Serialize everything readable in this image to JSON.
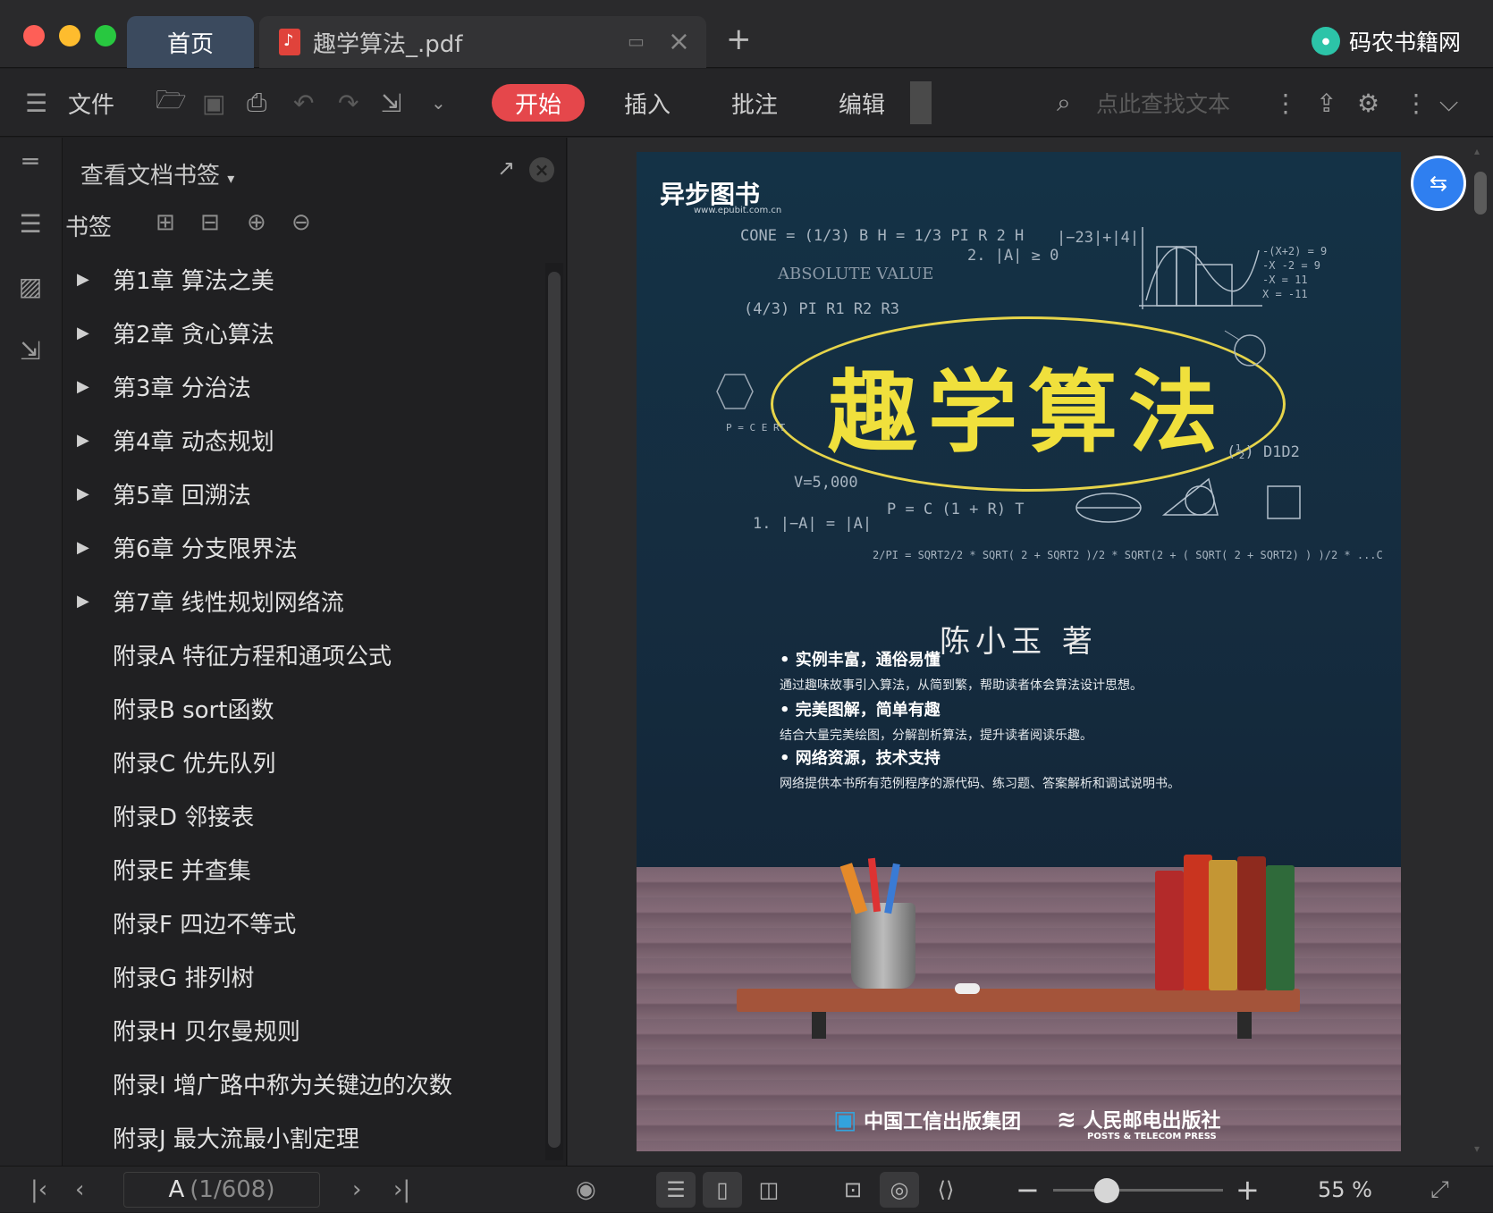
{
  "titlebar": {
    "home_tab": "首页",
    "doc_tab": "趣学算法_.pdf",
    "new_tab_symbol": "+",
    "brand": "码农书籍网"
  },
  "toolbar": {
    "menu_file": "文件",
    "start": "开始",
    "insert": "插入",
    "annotate": "批注",
    "edit": "编辑",
    "search_placeholder": "点此查找文本"
  },
  "panel": {
    "title": "查看文档书签",
    "bookmarks_label": "书签",
    "items": [
      {
        "label": "第1章  算法之美",
        "has_children": true
      },
      {
        "label": "第2章  贪心算法",
        "has_children": true
      },
      {
        "label": "第3章  分治法",
        "has_children": true
      },
      {
        "label": "第4章  动态规划",
        "has_children": true
      },
      {
        "label": "第5章  回溯法",
        "has_children": true
      },
      {
        "label": "第6章  分支限界法",
        "has_children": true
      },
      {
        "label": "第7章  线性规划网络流",
        "has_children": true
      },
      {
        "label": "附录A    特征方程和通项公式",
        "has_children": false
      },
      {
        "label": "附录B    sort函数",
        "has_children": false
      },
      {
        "label": "附录C    优先队列",
        "has_children": false
      },
      {
        "label": "附录D    邻接表",
        "has_children": false
      },
      {
        "label": "附录E    并查集",
        "has_children": false
      },
      {
        "label": "附录F    四边不等式",
        "has_children": false
      },
      {
        "label": "附录G    排列树",
        "has_children": false
      },
      {
        "label": "附录H    贝尔曼规则",
        "has_children": false
      },
      {
        "label": "附录I    增广路中称为关键边的次数",
        "has_children": false
      },
      {
        "label": "附录J    最大流最小割定理",
        "has_children": false
      }
    ]
  },
  "cover": {
    "publisher": "异步图书",
    "publisher_url": "www.epubit.com.cn",
    "title": "趣学算法",
    "author": "陈小玉  著",
    "formulas": {
      "f1": "CONE = (1/3) B H = 1/3 PI R 2 H",
      "f2": "ABSOLUTE VALUE",
      "f3": "(4/3) PI R1 R2 R3",
      "f4": "2.  |A| ≥ 0",
      "f5": "|−23|+|4|",
      "f6": "V=5,000",
      "f7": "1.  |−A| = |A|",
      "f8": "P = C (1 + R) T",
      "f9": "(½) D1D2",
      "f10": "2/PI = SQRT2/2 * SQRT( 2 + SQRT2 )/2 * SQRT(2 + ( SQRT( 2 + SQRT2) ) )/2 * ...C",
      "f11": "P = C E RT",
      "f12": "-(X+2) = 9",
      "f13": "-X -2 = 9",
      "f14": "-X = 11",
      "f15": "X = -11"
    },
    "features": [
      {
        "heading": "• 实例丰富，通俗易懂",
        "desc": "通过趣味故事引入算法，从简到繁，帮助读者体会算法设计思想。"
      },
      {
        "heading": "• 完美图解，简单有趣",
        "desc": "结合大量完美绘图，分解剖析算法，提升读者阅读乐趣。"
      },
      {
        "heading": "• 网络资源，技术支持",
        "desc": "网络提供本书所有范例程序的源代码、练习题、答案解析和调试说明书。"
      }
    ],
    "logo_left": "中国工信出版集团",
    "logo_right": "人民邮电出版社",
    "logo_right_en": "POSTS & TELECOM PRESS"
  },
  "statusbar": {
    "page_label": "A",
    "page_count": "(1/608)",
    "zoom": "55 %"
  }
}
